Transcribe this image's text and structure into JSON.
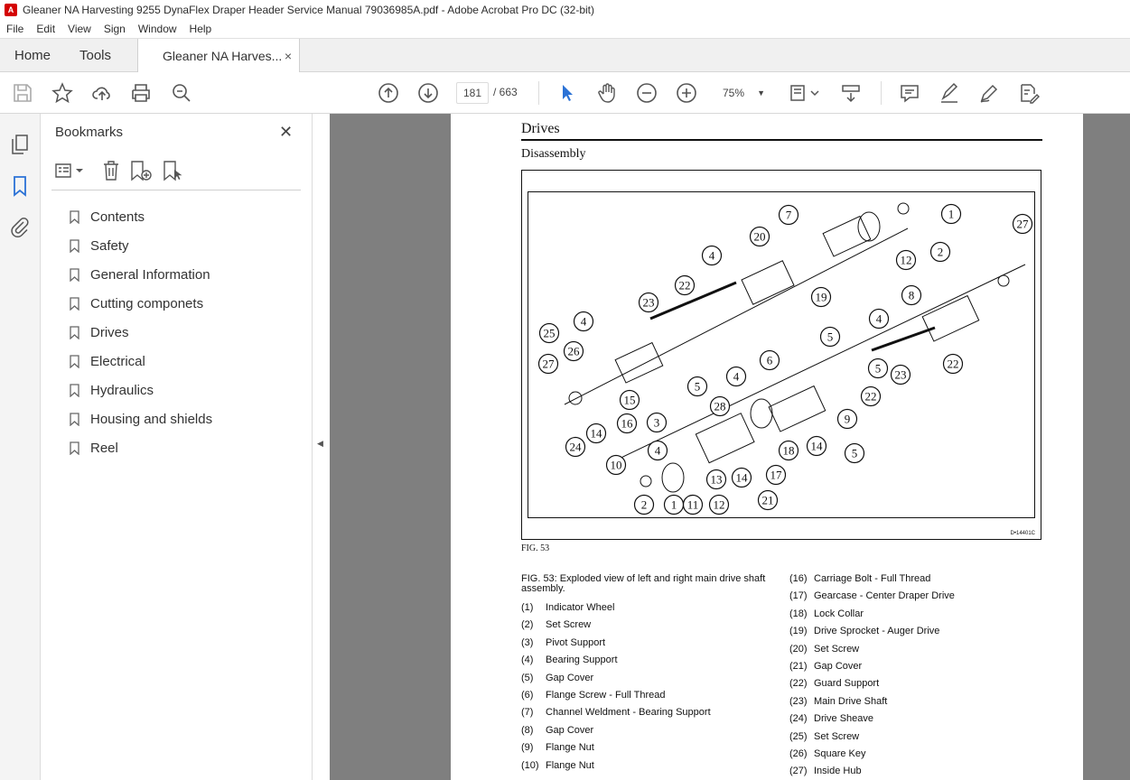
{
  "window": {
    "title": "Gleaner NA Harvesting 9255 DynaFlex Draper Header Service Manual 79036985A.pdf - Adobe Acrobat Pro DC (32-bit)"
  },
  "menu": [
    "File",
    "Edit",
    "View",
    "Sign",
    "Window",
    "Help"
  ],
  "tabs": {
    "home": "Home",
    "tools": "Tools",
    "doc": "Gleaner NA Harves...",
    "close": "×"
  },
  "toolbar": {
    "page_current": "181",
    "page_total": "/ 663",
    "zoom": "75%"
  },
  "bookmarks": {
    "title": "Bookmarks",
    "items": [
      "Contents",
      "Safety",
      "General Information",
      "Cutting componets",
      "Drives",
      "Electrical",
      "Hydraulics",
      "Housing and shields",
      "Reel"
    ]
  },
  "pdf": {
    "heading": "Drives",
    "subheading": "Disassembly",
    "fig_code": "D•14401C",
    "fig_label": "FIG. 53",
    "caption": "FIG. 53:  Exploded view of left and right main drive shaft assembly.",
    "parts_left": [
      {
        "n": "(1)",
        "t": "Indicator Wheel"
      },
      {
        "n": "(2)",
        "t": "Set Screw"
      },
      {
        "n": "(3)",
        "t": "Pivot Support"
      },
      {
        "n": "(4)",
        "t": "Bearing Support"
      },
      {
        "n": "(5)",
        "t": "Gap Cover"
      },
      {
        "n": "(6)",
        "t": "Flange Screw - Full Thread"
      },
      {
        "n": "(7)",
        "t": "Channel Weldment - Bearing Support"
      },
      {
        "n": "(8)",
        "t": "Gap Cover"
      },
      {
        "n": "(9)",
        "t": "Flange Nut"
      },
      {
        "n": "(10)",
        "t": "Flange Nut"
      }
    ],
    "parts_right": [
      {
        "n": "(16)",
        "t": "Carriage Bolt - Full Thread"
      },
      {
        "n": "(17)",
        "t": "Gearcase - Center Draper Drive"
      },
      {
        "n": "(18)",
        "t": "Lock Collar"
      },
      {
        "n": "(19)",
        "t": "Drive Sprocket - Auger Drive"
      },
      {
        "n": "(20)",
        "t": "Set Screw"
      },
      {
        "n": "(21)",
        "t": "Gap Cover"
      },
      {
        "n": "(22)",
        "t": "Guard Support"
      },
      {
        "n": "(23)",
        "t": "Main Drive Shaft"
      },
      {
        "n": "(24)",
        "t": "Drive Sheave"
      },
      {
        "n": "(25)",
        "t": "Set Screw"
      },
      {
        "n": "(26)",
        "t": "Square Key"
      },
      {
        "n": "(27)",
        "t": "Inside Hub"
      }
    ],
    "callouts": [
      "1",
      "2",
      "7",
      "20",
      "27",
      "12",
      "4",
      "8",
      "19",
      "22",
      "23",
      "5",
      "4",
      "22",
      "5",
      "25",
      "4",
      "26",
      "27",
      "15",
      "5",
      "6",
      "23",
      "22",
      "4",
      "16",
      "14",
      "3",
      "28",
      "24",
      "9",
      "18",
      "14",
      "5",
      "4",
      "10",
      "13",
      "14",
      "17",
      "21",
      "11",
      "12",
      "2",
      "1"
    ]
  }
}
